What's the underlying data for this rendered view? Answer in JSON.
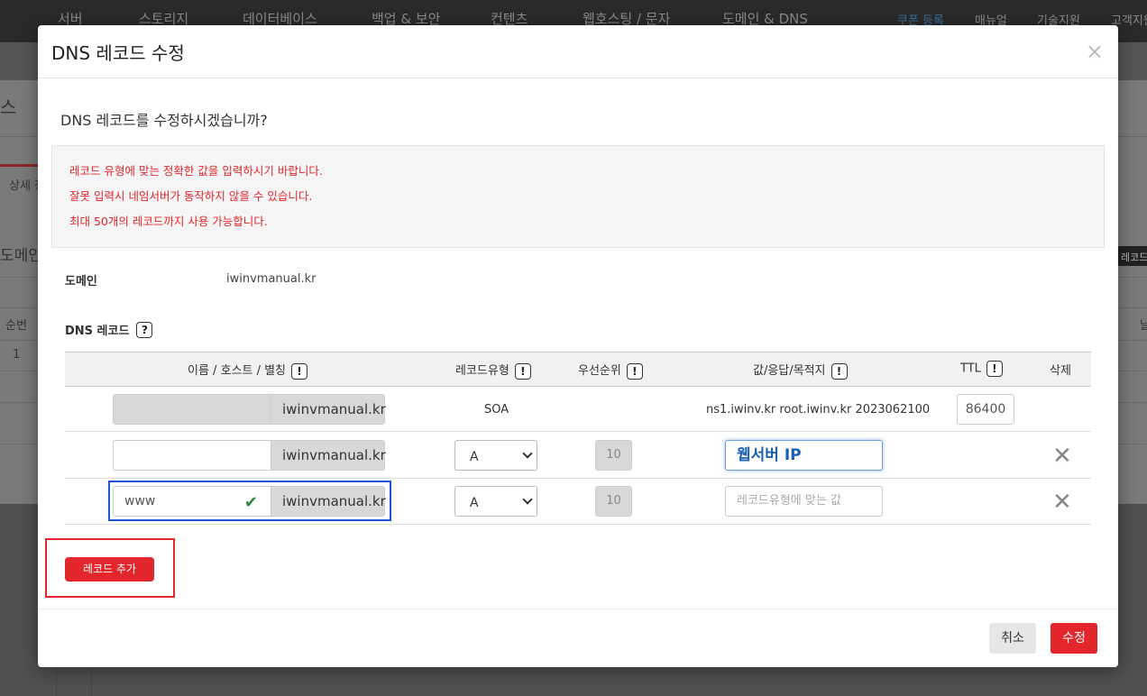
{
  "background": {
    "nav_items": [
      "서버",
      "스토리지",
      "데이터베이스",
      "백업 & 보안",
      "컨텐츠",
      "웹호스팅 / 문자",
      "도메인 & DNS"
    ],
    "coupon": "쿠폰 등록",
    "util_items": [
      "매뉴얼",
      "기술지원",
      "고객지원"
    ],
    "fragments": {
      "title": "스",
      "tab": "상세 정",
      "domain_heading": "도메인",
      "col_no": "순번",
      "row_no": "1",
      "right_btn": "레코드",
      "right_frag": "날"
    }
  },
  "modal": {
    "title": "DNS 레코드 수정",
    "close_icon": "×",
    "question": "DNS 레코드를 수정하시겠습니까?",
    "notices": [
      "레코드 유형에 맞는 정확한 값을 입력하시기 바랍니다.",
      "잘못 입력시 네임서버가 동작하지 않을 수 있습니다.",
      "최대 50개의 레코드까지 사용 가능합니다."
    ],
    "domain_label": "도메인",
    "domain_value": "iwinvmanual.kr",
    "dns_label": "DNS 레코드",
    "help_icon": "?",
    "excl_icon": "!",
    "columns": {
      "name": "이름 / 호스트 / 별칭",
      "type": "레코드유형",
      "priority": "우선순위",
      "value": "값/응답/목적지",
      "ttl": "TTL",
      "delete": "삭제"
    },
    "rows": [
      {
        "name": "",
        "suffix": "iwinvmanual.kr",
        "type": "SOA",
        "priority": "",
        "value": "ns1.iwinv.kr root.iwinv.kr 2023062100",
        "ttl": "86400"
      },
      {
        "name": "",
        "suffix": "iwinvmanual.kr",
        "type": "A",
        "priority": "10",
        "value": "웹서버 IP",
        "ttl": ""
      },
      {
        "name": "www",
        "suffix": "iwinvmanual.kr",
        "type": "A",
        "priority": "10",
        "value_placeholder": "레코드유형에 맞는 값",
        "ttl": ""
      }
    ],
    "check_icon": "✔",
    "delete_icon": "✕",
    "add_button": "레코드 추가",
    "cancel_button": "취소",
    "submit_button": "수정"
  },
  "colors": {
    "accent_red": "#e3262b",
    "highlight_blue": "#1f55d6",
    "valid_green": "#2e8b3e",
    "focus_text_blue": "#1a5fb4"
  }
}
